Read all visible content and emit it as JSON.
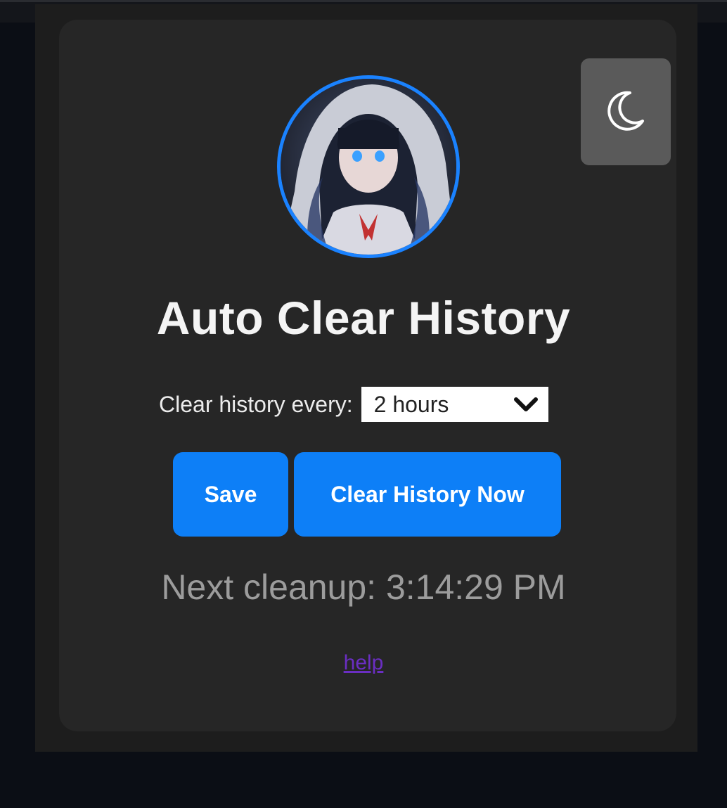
{
  "header": {
    "title": "Auto Clear History",
    "theme_toggle_icon": "moon-icon",
    "avatar_ring_color": "#1a82ff"
  },
  "settings": {
    "interval_label": "Clear history every:",
    "interval_selected": "2 hours"
  },
  "actions": {
    "save_label": "Save",
    "clear_now_label": "Clear History Now",
    "accent_color": "#0d7ff7"
  },
  "status": {
    "next_cleanup": "Next cleanup: 3:14:29 PM"
  },
  "footer": {
    "help_label": "help",
    "link_color": "#6a2ec2"
  }
}
